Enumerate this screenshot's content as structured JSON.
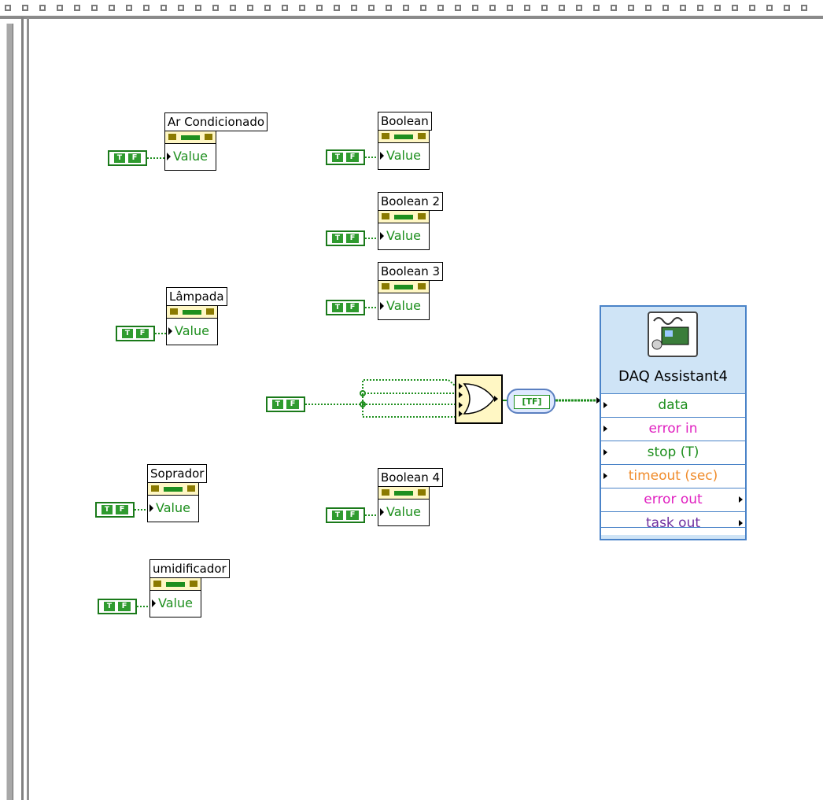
{
  "window": {
    "frame": "block-diagram"
  },
  "colors": {
    "wire_boolean": "#1e8f1e",
    "node_border": "#4a83c8",
    "node_fill": "#cfe4f6",
    "error_pink": "#e020c0",
    "timeout_orange": "#f08c2c",
    "stop_green": "#1e8f1e",
    "task_purple": "#7030a0"
  },
  "constant": {
    "icon_t": "T",
    "icon_f": "F"
  },
  "property_nodes": {
    "ar_condicionado": {
      "label": "Ar Condicionado",
      "value": "Value"
    },
    "boolean": {
      "label": "Boolean",
      "value": "Value"
    },
    "boolean_2": {
      "label": "Boolean 2",
      "value": "Value"
    },
    "boolean_3": {
      "label": "Boolean 3",
      "value": "Value"
    },
    "lampada": {
      "label": "Lâmpada",
      "value": "Value"
    },
    "soprador": {
      "label": "Soprador",
      "value": "Value"
    },
    "boolean_4": {
      "label": "Boolean 4",
      "value": "Value"
    },
    "umidificador": {
      "label": "umidificador",
      "value": "Value"
    }
  },
  "converter": {
    "text": "[TF]"
  },
  "daq": {
    "title": "DAQ Assistant4",
    "terminals": {
      "data": "data",
      "error_in": "error in",
      "stop": "stop (T)",
      "timeout": "timeout (sec)",
      "error_out": "error out",
      "task_out": "task out"
    }
  }
}
